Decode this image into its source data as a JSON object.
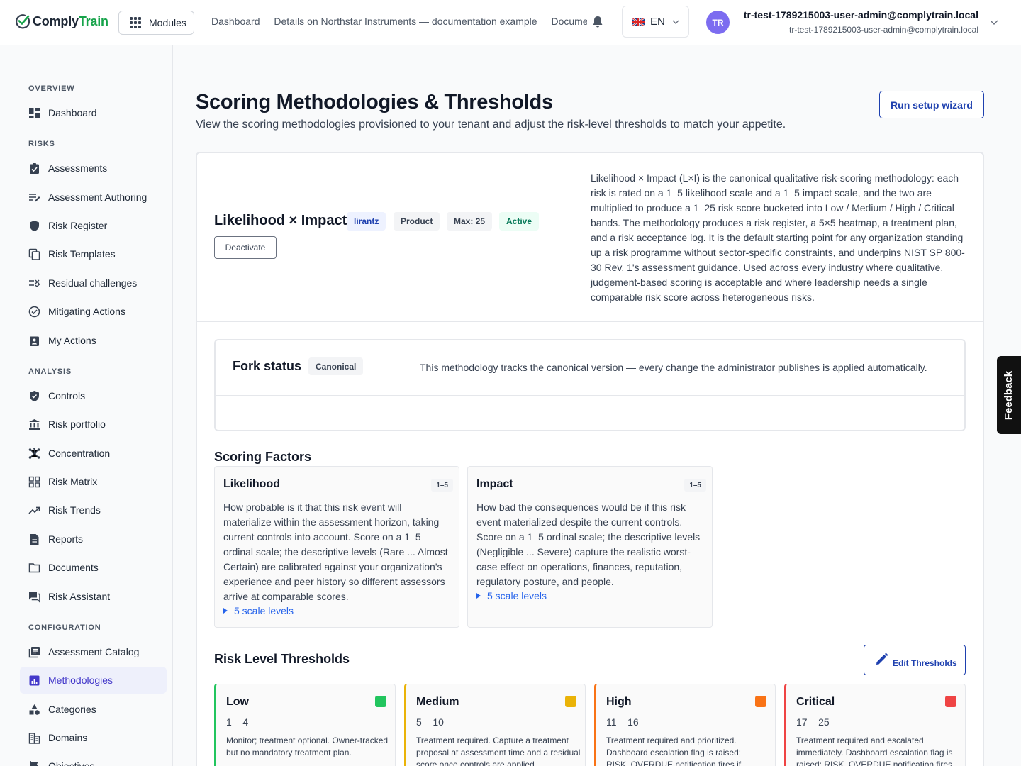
{
  "header": {
    "logo_part1": "Comply",
    "logo_part2": "Train",
    "modules_label": "Modules",
    "breadcrumbs": [
      "Dashboard",
      "Details on Northstar Instruments — documentation example",
      "Documents"
    ],
    "language": "EN",
    "avatar_initials": "TR",
    "user_name": "tr-test-1789215003-user-admin@complytrain.local",
    "user_email": "tr-test-1789215003-user-admin@complytrain.local"
  },
  "sidebar": {
    "sections": {
      "overview": "OVERVIEW",
      "risks": "RISKS",
      "analysis": "ANALYSIS",
      "configuration": "CONFIGURATION"
    },
    "items": {
      "dashboard": "Dashboard",
      "assessments": "Assessments",
      "assessment_authoring": "Assessment Authoring",
      "risk_register": "Risk Register",
      "risk_templates": "Risk Templates",
      "residual_challenges": "Residual challenges",
      "mitigating_actions": "Mitigating Actions",
      "my_actions": "My Actions",
      "controls": "Controls",
      "risk_portfolio": "Risk portfolio",
      "concentration": "Concentration",
      "risk_matrix": "Risk Matrix",
      "risk_trends": "Risk Trends",
      "reports": "Reports",
      "documents": "Documents",
      "risk_assistant": "Risk Assistant",
      "assessment_catalog": "Assessment Catalog",
      "methodologies": "Methodologies",
      "categories": "Categories",
      "domains": "Domains",
      "objectives": "Objectives"
    }
  },
  "page": {
    "title": "Scoring Methodologies & Thresholds",
    "subtitle": "View the scoring methodologies provisioned to your tenant and adjust the risk-level thresholds to match your appetite.",
    "wizard_button": "Run setup wizard"
  },
  "methodology": {
    "name": "Likelihood × Impact",
    "owner_badge": "lirantz",
    "type_badge": "Product",
    "max_badge": "Max: 25",
    "status_badge": "Active",
    "deactivate_button": "Deactivate",
    "description": "Likelihood × Impact (L×I) is the canonical qualitative risk-scoring methodology: each risk is rated on a 1–5 likelihood scale and a 1–5 impact scale, and the two are multiplied to produce a 1–25 risk score bucketed into Low / Medium / High / Critical bands. The methodology produces a risk register, a 5×5 heatmap, a treatment plan, and a risk acceptance log. It is the default starting point for any organization standing up a risk programme without sector-specific constraints, and underpins NIST SP 800-30 Rev. 1's assessment guidance. Used across every industry where qualitative, judgement-based scoring is acceptable and where leadership needs a single comparable risk score across heterogeneous risks."
  },
  "fork": {
    "title": "Fork status",
    "badge": "Canonical",
    "text": "This methodology tracks the canonical version — every change the administrator publishes is applied automatically."
  },
  "factors": {
    "heading": "Scoring Factors",
    "items": [
      {
        "name": "Likelihood",
        "range": "1–5",
        "description": "How probable is it that this risk event will materialize within the assessment horizon, taking current controls into account. Score on a 1–5 ordinal scale; the descriptive levels (Rare ... Almost Certain) are calibrated against your organization's experience and peer history so different assessors arrive at comparable scores.",
        "levels_link": "5 scale levels"
      },
      {
        "name": "Impact",
        "range": "1–5",
        "description": "How bad the consequences would be if this risk event materialized despite the current controls. Score on a 1–5 ordinal scale; the descriptive levels (Negligible ... Severe) capture the realistic worst-case effect on operations, finances, reputation, regulatory posture, and people.",
        "levels_link": "5 scale levels"
      }
    ]
  },
  "thresholds": {
    "heading": "Risk Level Thresholds",
    "edit_button": "Edit Thresholds",
    "items": [
      {
        "name": "Low",
        "range": "1 – 4",
        "color": "#22c55e",
        "description": "Monitor; treatment optional. Owner-tracked but no mandatory treatment plan."
      },
      {
        "name": "Medium",
        "range": "5 – 10",
        "color": "#eab308",
        "description": "Treatment required. Capture a treatment proposal at assessment time and a residual score once controls are applied."
      },
      {
        "name": "High",
        "range": "11 – 16",
        "color": "#f97316",
        "description": "Treatment required and prioritized. Dashboard escalation flag is raised; RISK_OVERDUE notification fires if overdue."
      },
      {
        "name": "Critical",
        "range": "17 – 25",
        "color": "#ef4444",
        "description": "Treatment required and escalated immediately. Dashboard escalation flag is raised; RISK_OVERDUE notification fires."
      }
    ]
  },
  "feedback_label": "Feedback"
}
